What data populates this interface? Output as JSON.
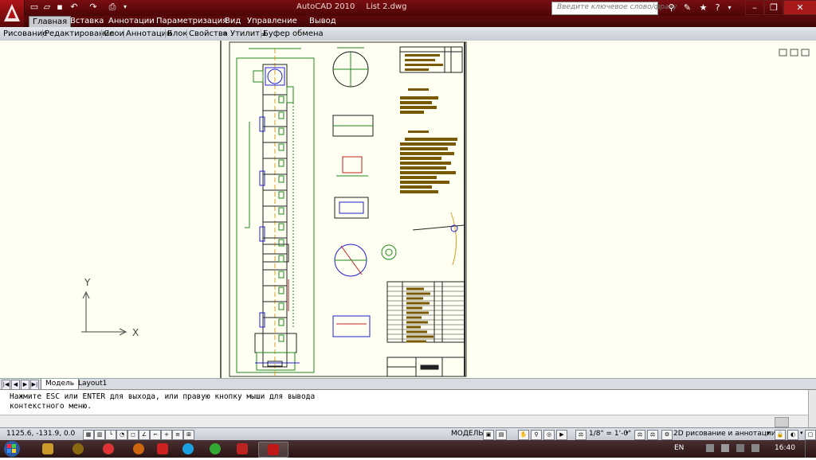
{
  "app": {
    "title": "AutoCAD 2010",
    "document": "List 2.dwg"
  },
  "search": {
    "placeholder": "Введите ключевое слово/фразу"
  },
  "ribbon_tabs": [
    "Главная",
    "Вставка",
    "Аннотации",
    "Параметризация",
    "Вид",
    "Управление",
    "Вывод"
  ],
  "ribbon_panels": [
    "Рисование",
    "Редактирование",
    "Слои",
    "Аннотации",
    "Блок",
    "Свойства",
    "Утилиты",
    "Буфер обмена"
  ],
  "panel_more_glyph": "»",
  "ucs": {
    "x_label": "X",
    "y_label": "Y"
  },
  "layout_tabs": {
    "model": "Модель",
    "layout1": "Layout1"
  },
  "command": {
    "line1": "Нажмите ESC или ENTER для выхода, или правую кнопку мыши для вывода",
    "line2": "контекстного меню."
  },
  "status": {
    "coords": "1125.6, -131.9, 0.0",
    "mode": "МОДЕЛЬ",
    "scale": "1/8\" = 1'-0\"",
    "workspace": "2D рисование и аннотации"
  },
  "tray": {
    "lang": "EN",
    "time": "16:40"
  },
  "icons": {
    "qat": [
      "new-icon",
      "open-icon",
      "save-icon",
      "undo-icon",
      "redo-icon",
      "plot-icon"
    ],
    "top_right": [
      "binoculars-icon",
      "tools-icon",
      "star-icon",
      "help-icon"
    ]
  },
  "colors": {
    "title_bar": "#6a0b0d",
    "canvas": "#fffff2",
    "drawing_green": "#1f8a1f",
    "drawing_brown": "#7a5800",
    "drawing_blue": "#2020d0"
  }
}
